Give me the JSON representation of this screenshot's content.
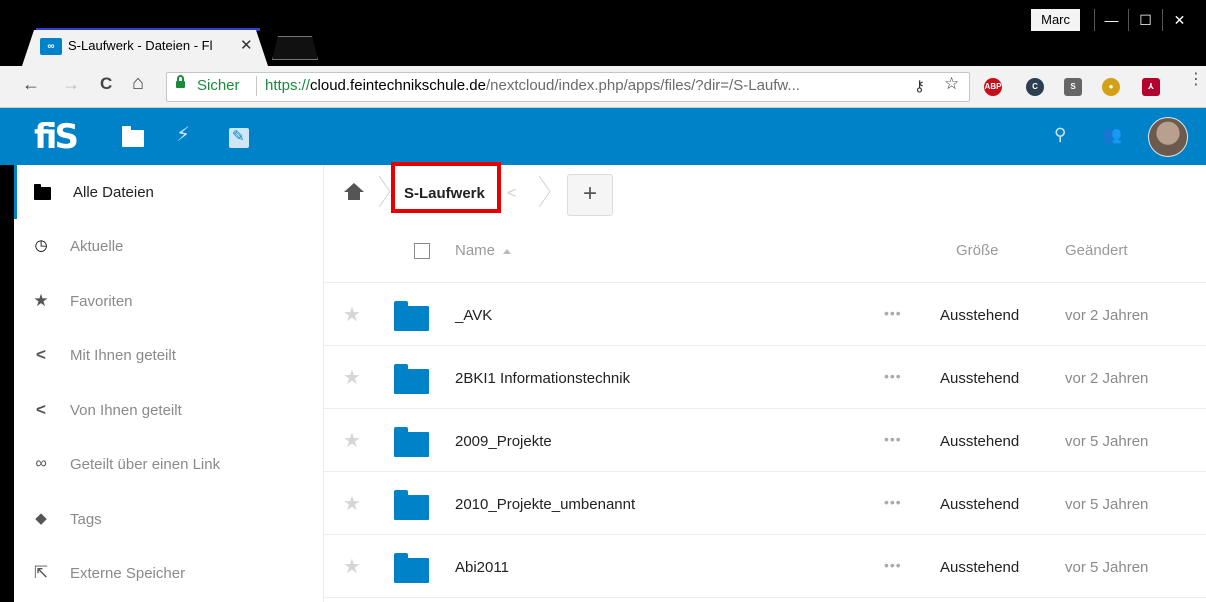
{
  "browser": {
    "tab_title": "S-Laufwerk - Dateien - Fl",
    "tab_favicon_text": "∞",
    "tab_close": "✕",
    "user_label": "Marc",
    "window_minimize": "—",
    "window_maximize": "☐",
    "window_close": "✕",
    "nav_back": "←",
    "nav_forward": "→",
    "nav_reload": "C",
    "nav_home": "⌂",
    "secure_label": "Sicher",
    "url_scheme": "https://",
    "url_host": "cloud.feintechnikschule.de",
    "url_path": "/nextcloud/index.php/apps/files/?dir=/S-Laufw...",
    "key_icon": "⚷",
    "bookmark_star": "☆",
    "extensions": [
      {
        "text": "ABP",
        "color": "#c4101a"
      },
      {
        "text": "C",
        "color": "#2c3e50"
      },
      {
        "text": "S",
        "color": "#666666"
      },
      {
        "text": "●",
        "color": "#d4a017"
      },
      {
        "text": "⅄",
        "color": "#b3002d"
      }
    ],
    "menu_dots": "⋮"
  },
  "nc_header": {
    "logo_text": "fiS",
    "bolt_icon": "⚡",
    "search_icon": "⚲",
    "contacts_icon": "👥"
  },
  "sidebar": {
    "items": [
      {
        "label": "Alle Dateien",
        "icon": "folder-icon",
        "glyph": ""
      },
      {
        "label": "Aktuelle",
        "icon": "clock-icon",
        "glyph": "🕓"
      },
      {
        "label": "Favoriten",
        "icon": "star-icon",
        "glyph": "★"
      },
      {
        "label": "Mit Ihnen geteilt",
        "icon": "share-icon",
        "glyph": "<"
      },
      {
        "label": "Von Ihnen geteilt",
        "icon": "share-icon",
        "glyph": "<"
      },
      {
        "label": "Geteilt über einen Link",
        "icon": "link-icon",
        "glyph": "🔗"
      },
      {
        "label": "Tags",
        "icon": "tag-icon",
        "glyph": "🏷"
      },
      {
        "label": "Externe Speicher",
        "icon": "external-storage-icon",
        "glyph": "⇱"
      }
    ]
  },
  "breadcrumb": {
    "current": "S-Laufwerk",
    "share_icon": "<",
    "new_button": "+"
  },
  "table": {
    "columns": {
      "name": "Name",
      "size": "Größe",
      "modified": "Geändert"
    },
    "rows": [
      {
        "name": "_AVK",
        "size": "Ausstehend",
        "modified": "vor 2 Jahren"
      },
      {
        "name": "2BKI1 Informationstechnik",
        "size": "Ausstehend",
        "modified": "vor 2 Jahren"
      },
      {
        "name": "2009_Projekte",
        "size": "Ausstehend",
        "modified": "vor 5 Jahren"
      },
      {
        "name": "2010_Projekte_umbenannt",
        "size": "Ausstehend",
        "modified": "vor 5 Jahren"
      },
      {
        "name": "Abi2011",
        "size": "Ausstehend",
        "modified": "vor 5 Jahren"
      }
    ],
    "star_glyph": "★",
    "actions_glyph": "•••"
  },
  "colors": {
    "brand": "#0082c9",
    "highlight": "#e60000",
    "secure": "#1b8a3d"
  }
}
